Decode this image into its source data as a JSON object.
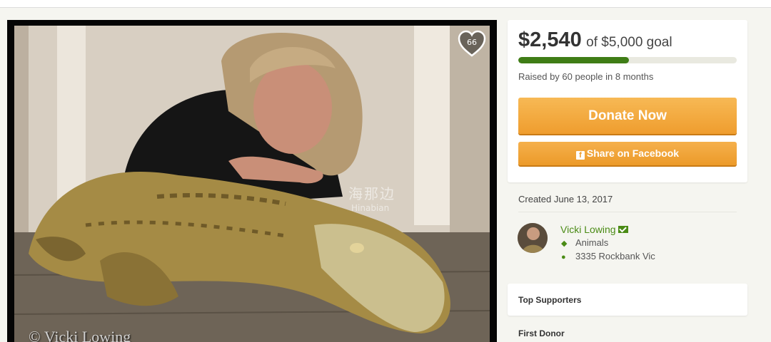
{
  "photo": {
    "like_count": "66",
    "watermark_cn": "海那边",
    "watermark_en": "Hinabian",
    "copyright": "© Vicki Lowing"
  },
  "campaign": {
    "amount_raised": "$2,540",
    "goal_text": "of $5,000 goal",
    "progress_fraction": 0.508,
    "raised_by": "Raised by 60 people in 8 months",
    "donate_label": "Donate Now",
    "share_label": "Share on Facebook",
    "fb_icon": "f"
  },
  "details": {
    "created": "Created June 13, 2017",
    "organizer_name": "Vicki Lowing",
    "category": "Animals",
    "location": "3335 Rockbank Vic"
  },
  "sections": {
    "top_supporters": "Top Supporters",
    "first_donor": "First Donor"
  },
  "colors": {
    "accent_green": "#3f7d16",
    "button_orange": "#ef9d2e"
  },
  "icons": [
    "heart-icon",
    "facebook-icon",
    "mail-icon",
    "tag-icon",
    "location-pin-icon"
  ]
}
